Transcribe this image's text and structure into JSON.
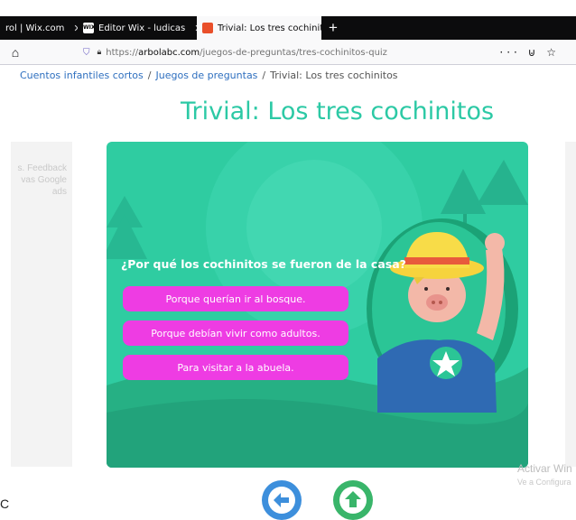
{
  "browser": {
    "tabs": [
      {
        "label": "rol | Wix.com",
        "active": false
      },
      {
        "label": "Editor Wix - ludicas",
        "active": false,
        "favicon": "WIX"
      },
      {
        "label": "Trivial: Los tres cochinitos | Árb",
        "active": true
      }
    ],
    "new_tab_icon": "plus-icon",
    "url": {
      "prefix": "https://",
      "host": "arbolabc.com",
      "path": "/juegos-de-preguntas/tres-cochinitos-quiz"
    },
    "actions": "··· ⊍ ☆"
  },
  "breadcrumb": {
    "items": [
      "Cuentos infantiles cortos",
      "Juegos de preguntas",
      "Trivial: Los tres cochinitos"
    ],
    "separator": "/"
  },
  "page_title": "Trivial: Los tres cochinitos",
  "ad_left_text": "s. Feedback\nvas Google\nads",
  "quiz": {
    "question": "¿Por qué los cochinitos se fueron de la casa?",
    "answers": [
      "Porque querían ir al bosque.",
      "Porque debían vivir como adultos.",
      "Para visitar a la abuela."
    ]
  },
  "watermark": {
    "title": "Activar Win",
    "subtitle": "Ve a Configura"
  },
  "stray_char": "C",
  "colors": {
    "accent": "#2cc9a5",
    "answer_button": "#ee3ce3",
    "back_button": "#3d8fdc",
    "home_button": "#39b56a"
  }
}
